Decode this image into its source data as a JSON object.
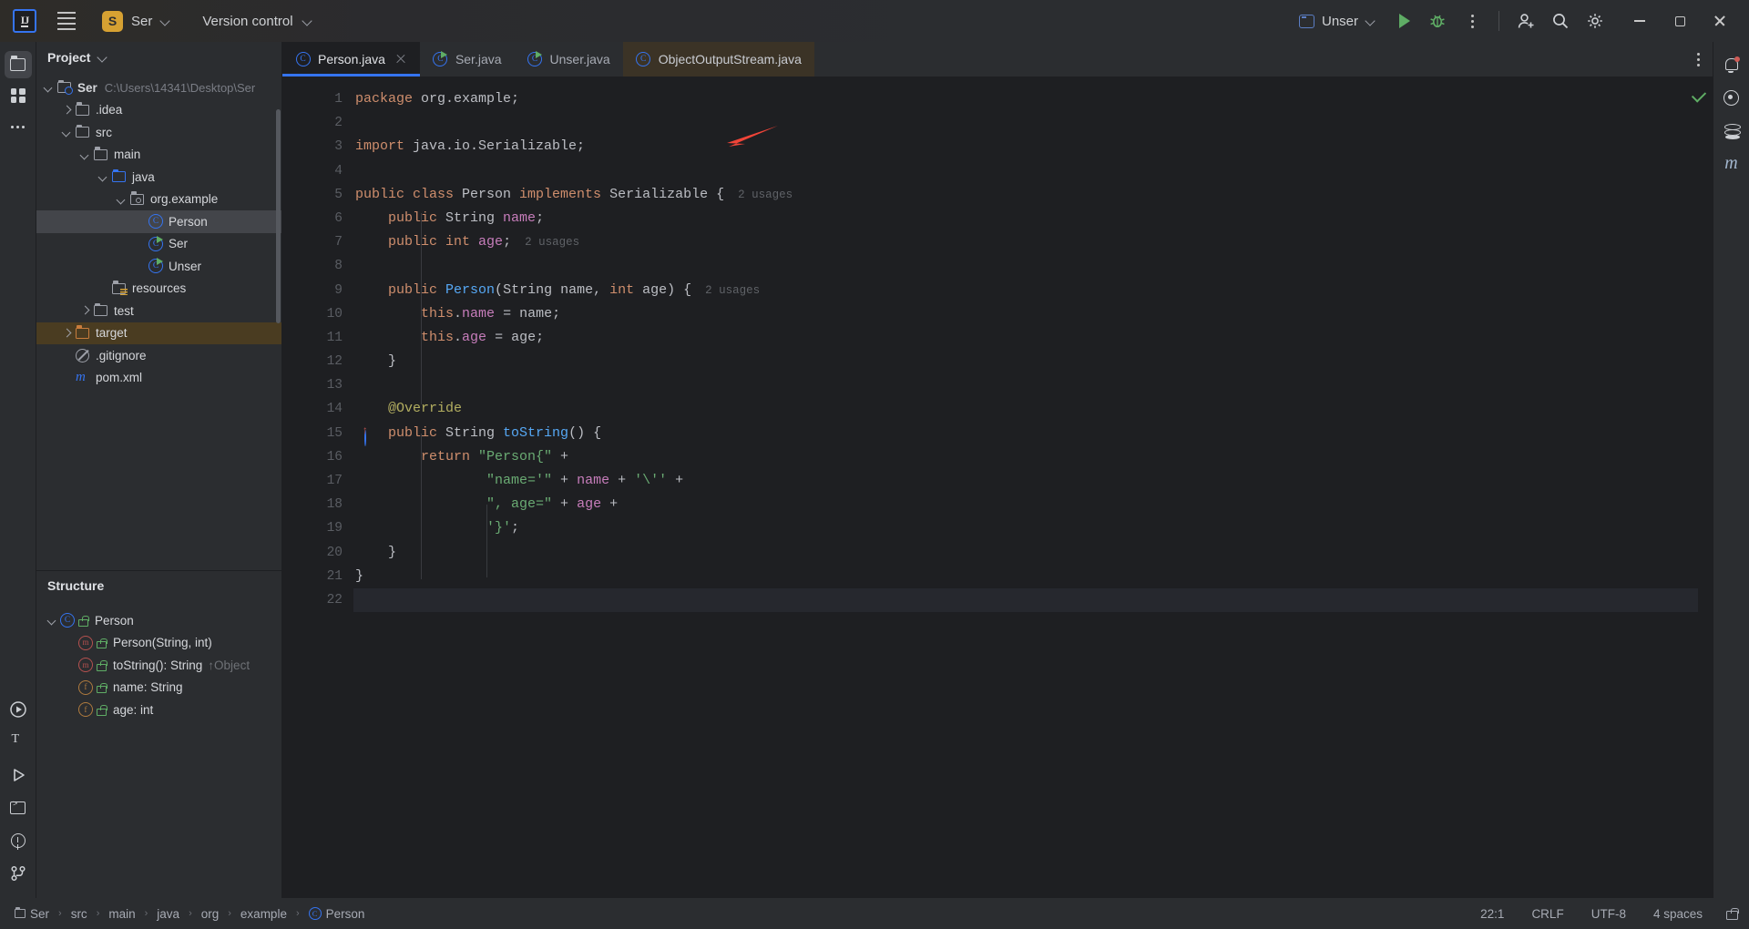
{
  "titlebar": {
    "logo": "IJ",
    "project_badge": "S",
    "project_name": "Ser",
    "version_control": "Version control",
    "run_config": "Unser",
    "icons": {
      "menu": "hamburger-icon",
      "run": "run-icon",
      "debug": "debug-icon",
      "more": "more-options-icon",
      "account": "account-icon",
      "search": "search-icon",
      "settings": "settings-icon"
    },
    "window": {
      "minimize": "minimize",
      "maximize": "maximize",
      "close": "close"
    }
  },
  "left_rail": {
    "items": [
      {
        "name": "project-tool-window",
        "icon": "folder-icon",
        "active": true
      },
      {
        "name": "commit-tool-window",
        "icon": "grid-icon",
        "active": false
      },
      {
        "name": "more-tool-windows",
        "icon": "dots-icon",
        "active": false
      }
    ],
    "bottom": [
      {
        "name": "run-tool-window",
        "icon": "run-icon"
      },
      {
        "name": "structure-tool-window",
        "icon": "text-icon"
      },
      {
        "name": "services-tool-window",
        "icon": "run-hollow-icon"
      },
      {
        "name": "terminal-tool-window",
        "icon": "terminal-icon"
      },
      {
        "name": "problems-tool-window",
        "icon": "warning-icon"
      },
      {
        "name": "version-control-tool-window",
        "icon": "branch-icon"
      }
    ]
  },
  "project_panel": {
    "title": "Project",
    "tree": [
      {
        "label": "Ser",
        "path": "C:\\Users\\14341\\Desktop\\Ser",
        "indent": 0,
        "arrow": "down",
        "icon": "module-folder",
        "bold": true
      },
      {
        "label": ".idea",
        "indent": 1,
        "arrow": "right",
        "icon": "folder"
      },
      {
        "label": "src",
        "indent": 1,
        "arrow": "down",
        "icon": "folder"
      },
      {
        "label": "main",
        "indent": 2,
        "arrow": "down",
        "icon": "folder"
      },
      {
        "label": "java",
        "indent": 3,
        "arrow": "down",
        "icon": "folder-blue"
      },
      {
        "label": "org.example",
        "indent": 4,
        "arrow": "down",
        "icon": "package"
      },
      {
        "label": "Person",
        "indent": 5,
        "arrow": "none",
        "icon": "class",
        "selected": true
      },
      {
        "label": "Ser",
        "indent": 5,
        "arrow": "none",
        "icon": "class-runnable"
      },
      {
        "label": "Unser",
        "indent": 5,
        "arrow": "none",
        "icon": "class-runnable"
      },
      {
        "label": "resources",
        "indent": 3,
        "arrow": "none",
        "icon": "folder-resources"
      },
      {
        "label": "test",
        "indent": 2,
        "arrow": "right",
        "icon": "folder"
      },
      {
        "label": "target",
        "indent": 1,
        "arrow": "right",
        "icon": "folder-orange",
        "highlighted": true
      },
      {
        "label": ".gitignore",
        "indent": 1,
        "arrow": "none",
        "icon": "gitignore"
      },
      {
        "label": "pom.xml",
        "indent": 1,
        "arrow": "none",
        "icon": "maven"
      }
    ]
  },
  "structure_panel": {
    "title": "Structure",
    "items": [
      {
        "label": "Person",
        "sub": "",
        "indent": 0,
        "arrow": "down",
        "icon": "class"
      },
      {
        "label": "Person(String, int)",
        "sub": "",
        "indent": 1,
        "arrow": "none",
        "icon": "method"
      },
      {
        "label": "toString(): String",
        "sub": "↑Object",
        "indent": 1,
        "arrow": "none",
        "icon": "method"
      },
      {
        "label": "name: String",
        "sub": "",
        "indent": 1,
        "arrow": "none",
        "icon": "field"
      },
      {
        "label": "age: int",
        "sub": "",
        "indent": 1,
        "arrow": "none",
        "icon": "field"
      }
    ]
  },
  "editor": {
    "tabs": [
      {
        "label": "Person.java",
        "icon": "class",
        "active": true,
        "closable": true
      },
      {
        "label": "Ser.java",
        "icon": "class-runnable",
        "active": false
      },
      {
        "label": "Unser.java",
        "icon": "class-runnable",
        "active": false
      },
      {
        "label": "ObjectOutputStream.java",
        "icon": "class",
        "active": false,
        "readonly": true
      }
    ],
    "tab_options_icon": "more-options-icon",
    "line_numbers": [
      "1",
      "2",
      "3",
      "4",
      "5",
      "6",
      "7",
      "8",
      "9",
      "10",
      "11",
      "12",
      "13",
      "14",
      "15",
      "16",
      "17",
      "18",
      "19",
      "20",
      "21",
      "22"
    ],
    "lines": [
      {
        "n": 1,
        "tokens": [
          {
            "t": "package ",
            "c": "kw"
          },
          {
            "t": "org.example;",
            "c": "punct"
          }
        ]
      },
      {
        "n": 2,
        "tokens": []
      },
      {
        "n": 3,
        "tokens": [
          {
            "t": "import ",
            "c": "kw"
          },
          {
            "t": "java.io.Serializable;",
            "c": "punct"
          }
        ]
      },
      {
        "n": 4,
        "tokens": []
      },
      {
        "n": 5,
        "tokens": [
          {
            "t": "public ",
            "c": "kw"
          },
          {
            "t": "class ",
            "c": "kw"
          },
          {
            "t": "Person ",
            "c": "cls-n"
          },
          {
            "t": "implements ",
            "c": "kw"
          },
          {
            "t": "Serializable ",
            "c": "cls-n"
          },
          {
            "t": "{",
            "c": "punct"
          },
          {
            "t": "  2 usages",
            "c": "usages"
          }
        ]
      },
      {
        "n": 6,
        "tokens": [
          {
            "t": "    ",
            "c": "punct"
          },
          {
            "t": "public ",
            "c": "kw"
          },
          {
            "t": "String ",
            "c": "cls-n"
          },
          {
            "t": "name",
            "c": "field"
          },
          {
            "t": ";",
            "c": "punct"
          }
        ]
      },
      {
        "n": 7,
        "tokens": [
          {
            "t": "    ",
            "c": "punct"
          },
          {
            "t": "public ",
            "c": "kw"
          },
          {
            "t": "int ",
            "c": "kw"
          },
          {
            "t": "age",
            "c": "field"
          },
          {
            "t": ";",
            "c": "punct"
          },
          {
            "t": "  2 usages",
            "c": "usages"
          }
        ]
      },
      {
        "n": 8,
        "tokens": []
      },
      {
        "n": 9,
        "tokens": [
          {
            "t": "    ",
            "c": "punct"
          },
          {
            "t": "public ",
            "c": "kw"
          },
          {
            "t": "Person",
            "c": "meth"
          },
          {
            "t": "(",
            "c": "punct"
          },
          {
            "t": "String ",
            "c": "cls-n"
          },
          {
            "t": "name",
            "c": "punct"
          },
          {
            "t": ", ",
            "c": "punct"
          },
          {
            "t": "int ",
            "c": "kw"
          },
          {
            "t": "age",
            "c": "punct"
          },
          {
            "t": ") ",
            "c": "punct"
          },
          {
            "t": "{",
            "c": "punct"
          },
          {
            "t": "  2 usages",
            "c": "usages"
          }
        ]
      },
      {
        "n": 10,
        "tokens": [
          {
            "t": "        ",
            "c": "punct"
          },
          {
            "t": "this",
            "c": "kw"
          },
          {
            "t": ".",
            "c": "punct"
          },
          {
            "t": "name",
            "c": "field"
          },
          {
            "t": " = name;",
            "c": "punct"
          }
        ]
      },
      {
        "n": 11,
        "tokens": [
          {
            "t": "        ",
            "c": "punct"
          },
          {
            "t": "this",
            "c": "kw"
          },
          {
            "t": ".",
            "c": "punct"
          },
          {
            "t": "age",
            "c": "field"
          },
          {
            "t": " = age;",
            "c": "punct"
          }
        ]
      },
      {
        "n": 12,
        "tokens": [
          {
            "t": "    }",
            "c": "punct"
          }
        ]
      },
      {
        "n": 13,
        "tokens": []
      },
      {
        "n": 14,
        "tokens": [
          {
            "t": "    ",
            "c": "punct"
          },
          {
            "t": "@Override",
            "c": "ann"
          }
        ]
      },
      {
        "n": 15,
        "tokens": [
          {
            "t": "    ",
            "c": "punct"
          },
          {
            "t": "public ",
            "c": "kw"
          },
          {
            "t": "String ",
            "c": "cls-n"
          },
          {
            "t": "toString",
            "c": "meth"
          },
          {
            "t": "() ",
            "c": "punct"
          },
          {
            "t": "{",
            "c": "punct"
          }
        ]
      },
      {
        "n": 16,
        "tokens": [
          {
            "t": "        ",
            "c": "punct"
          },
          {
            "t": "return ",
            "c": "kw"
          },
          {
            "t": "\"Person{\"",
            "c": "str"
          },
          {
            "t": " +",
            "c": "punct"
          }
        ]
      },
      {
        "n": 17,
        "tokens": [
          {
            "t": "                ",
            "c": "punct"
          },
          {
            "t": "\"name='\"",
            "c": "str"
          },
          {
            "t": " + ",
            "c": "punct"
          },
          {
            "t": "name",
            "c": "field"
          },
          {
            "t": " + ",
            "c": "punct"
          },
          {
            "t": "'\\''",
            "c": "str"
          },
          {
            "t": " +",
            "c": "punct"
          }
        ]
      },
      {
        "n": 18,
        "tokens": [
          {
            "t": "                ",
            "c": "punct"
          },
          {
            "t": "\", age=\"",
            "c": "str"
          },
          {
            "t": " + ",
            "c": "punct"
          },
          {
            "t": "age",
            "c": "field"
          },
          {
            "t": " +",
            "c": "punct"
          }
        ]
      },
      {
        "n": 19,
        "tokens": [
          {
            "t": "                ",
            "c": "punct"
          },
          {
            "t": "'}'",
            "c": "str"
          },
          {
            "t": ";",
            "c": "punct"
          }
        ]
      },
      {
        "n": 20,
        "tokens": [
          {
            "t": "    }",
            "c": "punct"
          }
        ]
      },
      {
        "n": 21,
        "tokens": [
          {
            "t": "}",
            "c": "punct"
          }
        ]
      },
      {
        "n": 22,
        "tokens": []
      }
    ],
    "override_gutter_line": 15,
    "inspection_status": "ok"
  },
  "right_rail": {
    "items": [
      {
        "name": "notifications",
        "icon": "bell-icon",
        "badge": true
      },
      {
        "name": "ai-assistant",
        "icon": "ai-icon"
      },
      {
        "name": "database",
        "icon": "database-icon"
      },
      {
        "name": "maven",
        "icon": "maven-icon"
      }
    ]
  },
  "statusbar": {
    "breadcrumbs": [
      {
        "label": "Ser",
        "icon": "folder"
      },
      {
        "label": "src",
        "icon": "none"
      },
      {
        "label": "main",
        "icon": "none"
      },
      {
        "label": "java",
        "icon": "none"
      },
      {
        "label": "org",
        "icon": "none"
      },
      {
        "label": "example",
        "icon": "none"
      },
      {
        "label": "Person",
        "icon": "class"
      }
    ],
    "separator": "›",
    "right": {
      "caret": "22:1",
      "line_separator": "CRLF",
      "encoding": "UTF-8",
      "indent": "4 spaces",
      "lock_icon": "unlocked-icon"
    }
  },
  "colors": {
    "accent": "#3574f0",
    "keyword": "#cf8e6d",
    "string": "#6aab73",
    "field": "#c77dbb",
    "method": "#56a8f5",
    "annotation": "#b3ae60",
    "background": "#1e1f22",
    "panel": "#2b2d30",
    "annotation_arrow": "#f04438"
  }
}
